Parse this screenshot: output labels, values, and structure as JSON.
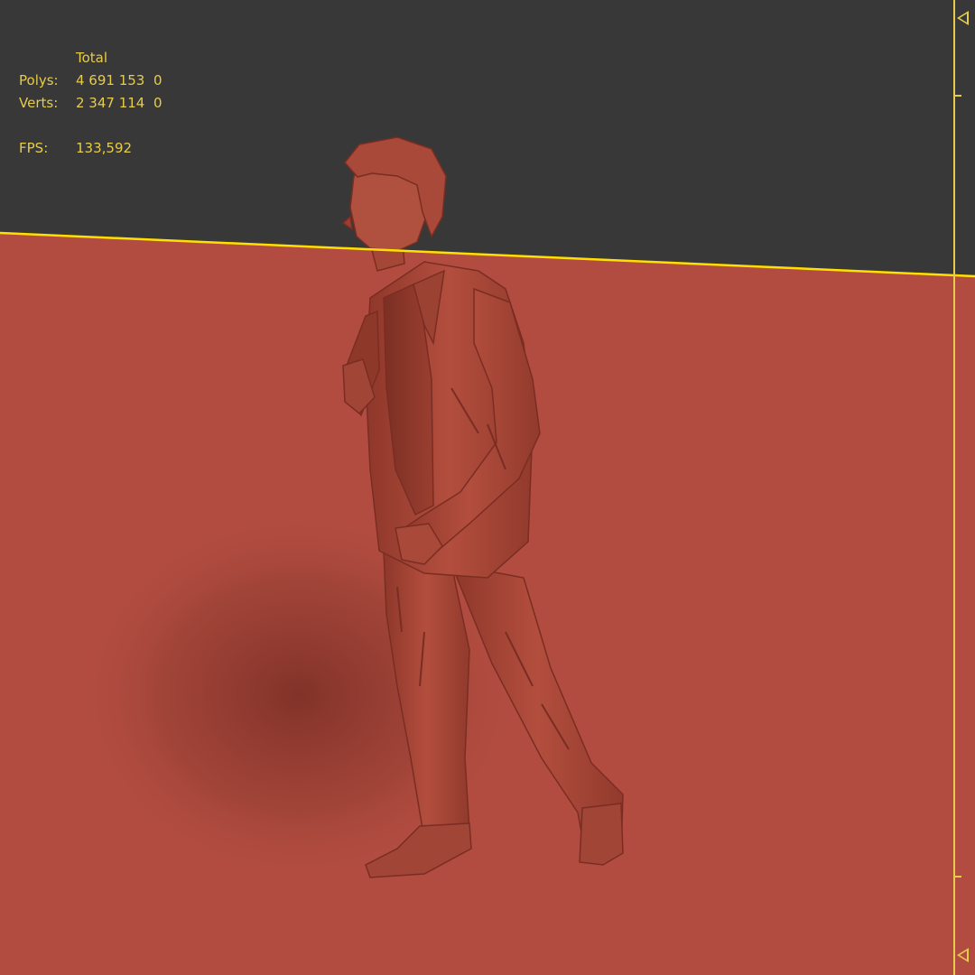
{
  "viewport": {
    "statistics": {
      "header": "Total",
      "rows": [
        {
          "label": "Polys:",
          "total": "4 691 153",
          "selected": "0"
        },
        {
          "label": "Verts:",
          "total": "2 347 114",
          "selected": "0"
        }
      ],
      "fps": {
        "label": "FPS:",
        "value": "133,592"
      }
    },
    "colors": {
      "background": "#383838",
      "ground_plane": "#b24c40",
      "model": "#a84536",
      "overlay_text": "#e6cc4a",
      "horizon_line": "#ffe000"
    },
    "model_icon": "human-figure-sculpt",
    "time_slider_icons": [
      "triangle-marker-top",
      "triangle-marker-bottom"
    ]
  }
}
